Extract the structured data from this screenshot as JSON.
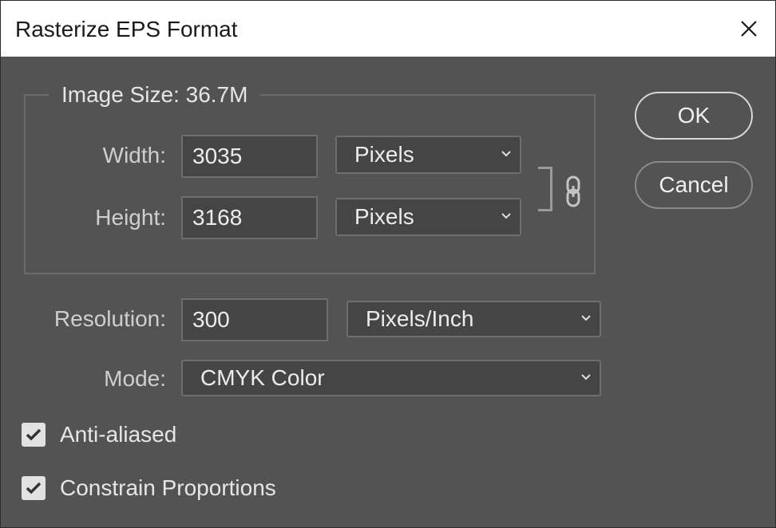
{
  "window": {
    "title": "Rasterize EPS Format",
    "close_icon": "close-icon"
  },
  "image_size": {
    "legend": "Image Size: 36.7M"
  },
  "width": {
    "label": "Width:",
    "value": "3035",
    "unit": "Pixels"
  },
  "height": {
    "label": "Height:",
    "value": "3168",
    "unit": "Pixels"
  },
  "link_icon": "chain-link-icon",
  "resolution": {
    "label": "Resolution:",
    "value": "300",
    "unit": "Pixels/Inch"
  },
  "mode": {
    "label": "Mode:",
    "value": "CMYK Color"
  },
  "options": {
    "anti_aliased": {
      "label": "Anti-aliased",
      "checked": true
    },
    "constrain_proportions": {
      "label": "Constrain Proportions",
      "checked": true
    }
  },
  "buttons": {
    "ok": "OK",
    "cancel": "Cancel"
  },
  "colors": {
    "dialog_bg": "#535353",
    "titlebar_bg": "#ffffff",
    "field_bg": "#454545",
    "text": "#ececec",
    "label_text": "#cfcfcf"
  }
}
